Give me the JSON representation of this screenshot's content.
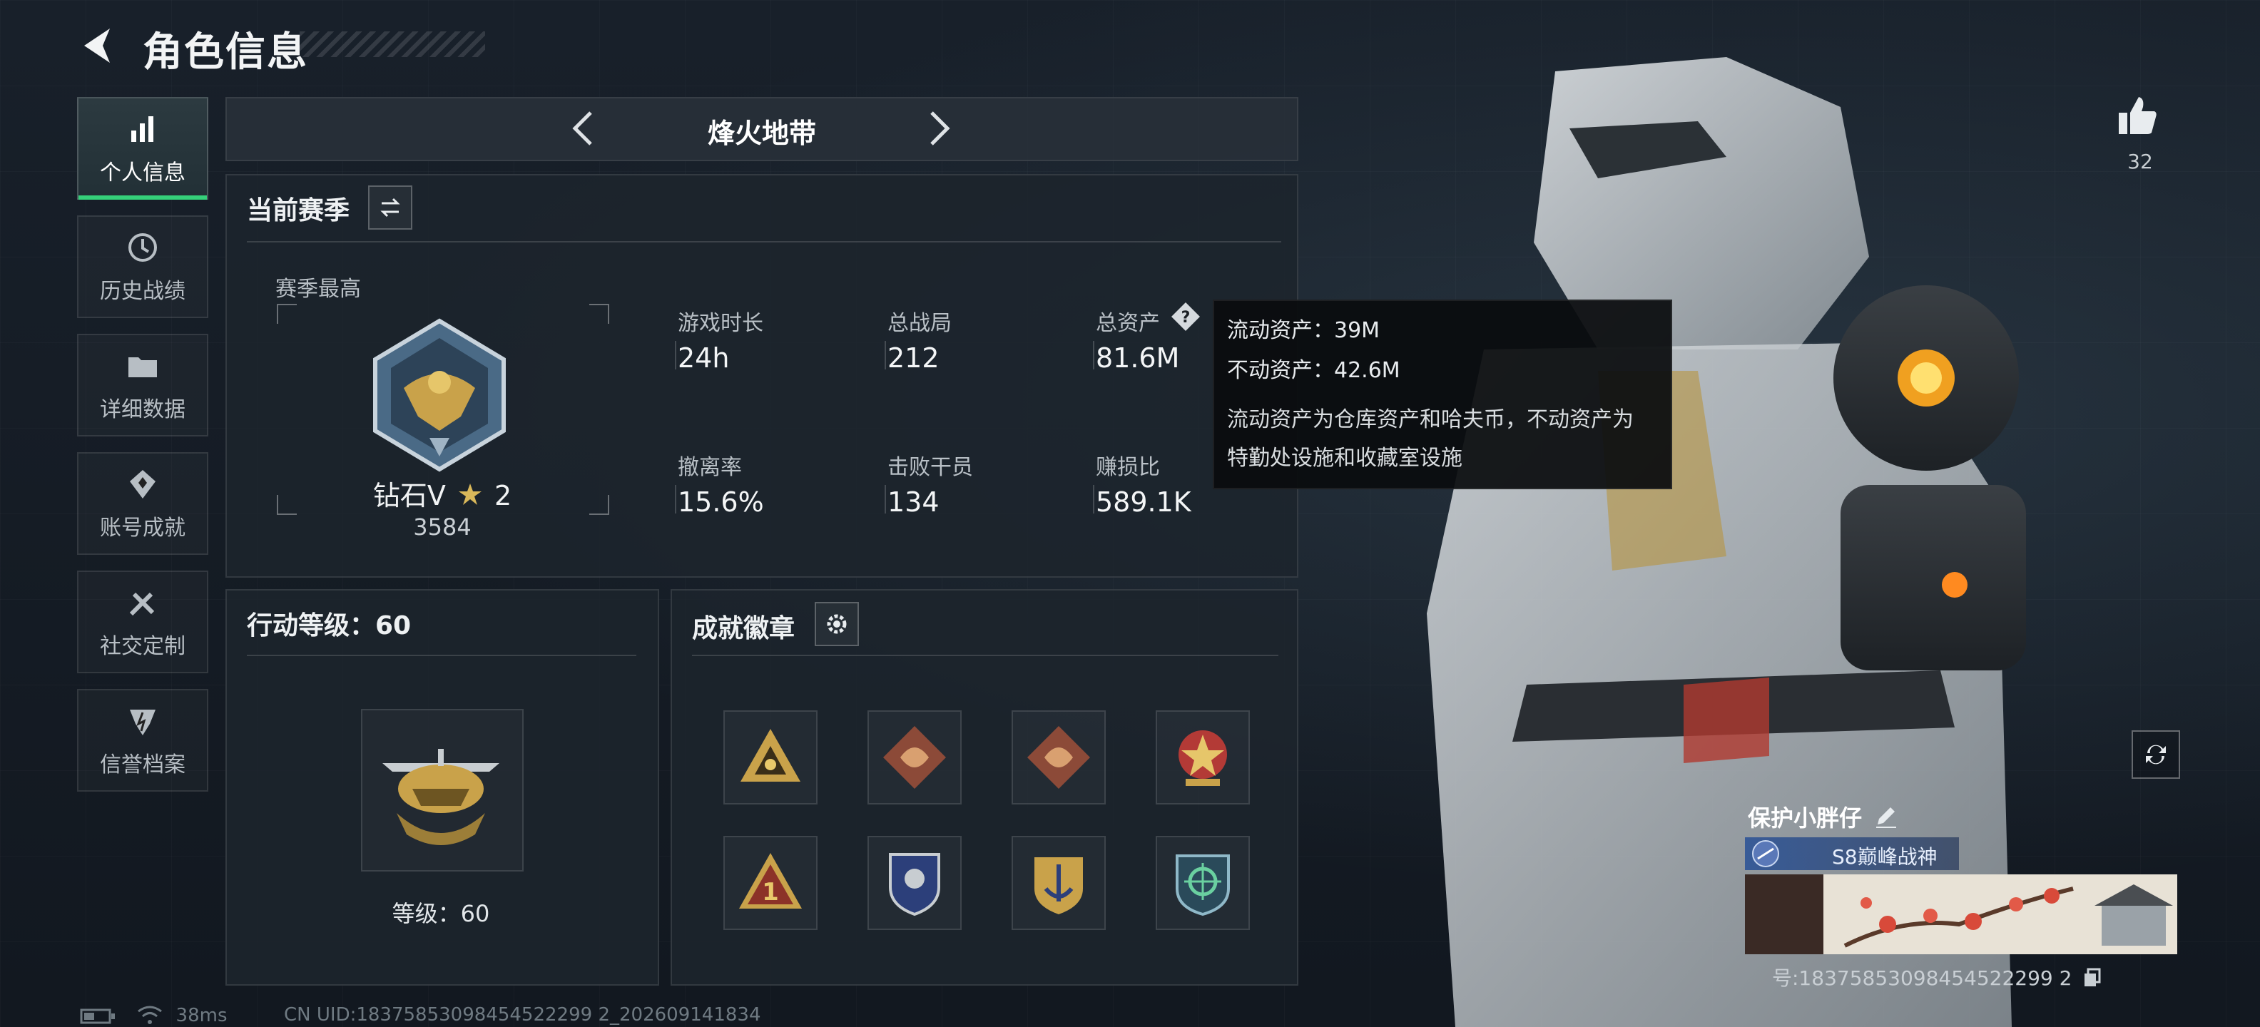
{
  "header": {
    "title": "角色信息"
  },
  "nav": {
    "items": [
      {
        "label": "个人信息",
        "icon": "bar-chart-icon",
        "active": true
      },
      {
        "label": "历史战绩",
        "icon": "clock-history-icon"
      },
      {
        "label": "详细数据",
        "icon": "folder-icon"
      },
      {
        "label": "账号成就",
        "icon": "medal-icon"
      },
      {
        "label": "社交定制",
        "icon": "tools-icon"
      },
      {
        "label": "信誉档案",
        "icon": "shield-icon"
      }
    ]
  },
  "mode": {
    "title": "烽火地带"
  },
  "season": {
    "title": "当前赛季",
    "best_label": "赛季最高",
    "rank_name": "钻石V",
    "rank_star": "2",
    "rank_score": "3584",
    "stats": [
      {
        "label": "游戏时长",
        "value": "24h"
      },
      {
        "label": "总战局",
        "value": "212"
      },
      {
        "label": "总资产",
        "value": "81.6M"
      },
      {
        "label": "撤离率",
        "value": "15.6%"
      },
      {
        "label": "击败干员",
        "value": "134"
      },
      {
        "label": "赚损比",
        "value": "589.1K"
      }
    ]
  },
  "tooltip": {
    "liquid": "流动资产：39M",
    "fixed": "不动资产：42.6M",
    "desc": "流动资产为仓库资产和哈夫币，不动资产为特勤处设施和收藏室设施"
  },
  "level": {
    "title": "行动等级：60",
    "label": "等级：60"
  },
  "badges": {
    "title": "成就徽章",
    "items": [
      "triangle-eye-badge",
      "dragon-badge",
      "dragon-badge",
      "star-wreath-badge",
      "number-one-badge",
      "blue-shield-badge",
      "gold-anchor-badge",
      "crosshair-shield-badge"
    ]
  },
  "player": {
    "likes": "32",
    "name": "保护小胖仔",
    "title": "S8巅峰战神",
    "uid_display": "号:18375853098454522299 2"
  },
  "status": {
    "ping": "38ms",
    "uid": "CN UID:18375853098454522299 2_202609141834"
  },
  "colors": {
    "accent_green": "#35d17a",
    "panel": "#1c242c",
    "gold": "#c9a24a"
  }
}
